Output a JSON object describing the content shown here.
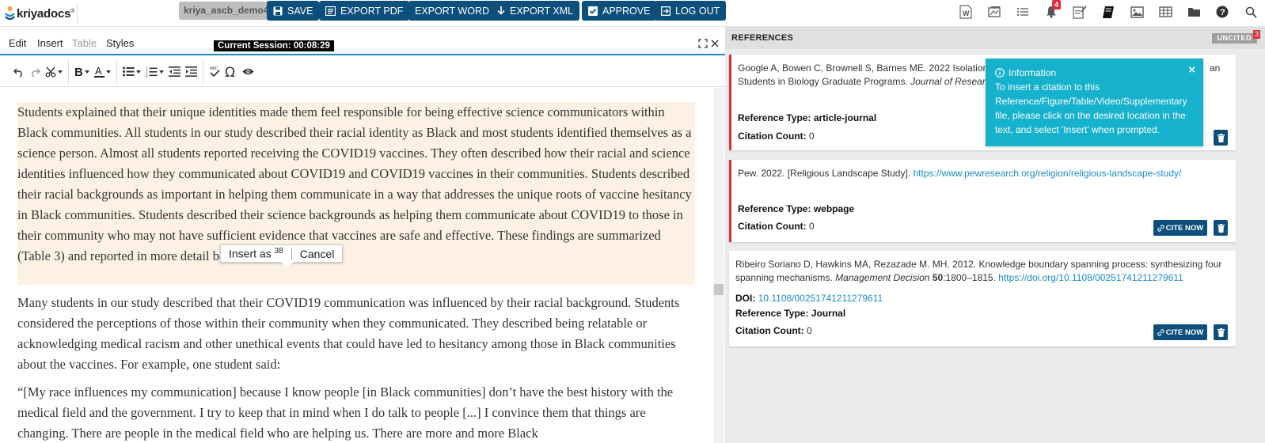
{
  "app": {
    "logo_text": "kriyadocs",
    "logo_mark": "®"
  },
  "topbar": {
    "user": "kriya_ascb_demo4",
    "buttons": [
      {
        "label": "SAVE",
        "icon": "save-icon"
      },
      {
        "label": "EXPORT PDF",
        "icon": "pdf-icon"
      },
      {
        "label": "EXPORT WORD",
        "icon": ""
      },
      {
        "label": "EXPORT XML",
        "icon": "download-icon"
      },
      {
        "label": "APPROVE",
        "icon": "check-icon"
      },
      {
        "label": "LOG OUT",
        "icon": "logout-icon"
      }
    ],
    "icons": [
      "word-icon",
      "image-gallery-icon",
      "list-icon",
      "bell-icon",
      "edit-notes-icon",
      "book-icon",
      "picture-icon",
      "table-icon",
      "folder-icon",
      "help-icon",
      "search-icon"
    ],
    "notification_count": "4"
  },
  "editor": {
    "menu": [
      "Edit",
      "Insert",
      "Table",
      "Styles"
    ],
    "session": "Current Session: 00:08:29",
    "paragraphs": [
      "Students explained that their unique identities made them feel responsible for being effective science communicators within Black communities. All students in our study described their racial identity as Black and most students identified themselves as a science person. Almost all students reported receiving the COVID19 vaccines. They often described how their racial and science identities influenced how they communicated about COVID19 and COVID19 vaccines in their communities. Students described their racial backgrounds as important in helping them communicate in a way that addresses the unique roots of vaccine hesitancy in Black communities. Students described their science backgrounds as helping them communicate about COVID19 to those in their community who may not have sufficient evidence that vaccines are safe and effective. These findings are summarized (Table 3) and reported in more detail below.",
      "Many students in our study described that their COVID19 communication was influenced by their racial background. Students considered the perceptions of those within their community when they communicated. They described being relatable or acknowledging medical racism and other unethical events that could have led to hesitancy among those in Black communities about the vaccines. For example, one student said:",
      "“[My race influences my communication] because I know people [in Black communities] don’t have the best history with the medical field and the government. I try to keep that in mind when I do talk to people [...] I convince them that things are changing. There are people in the medical field who are helping us. There are more and more Black"
    ],
    "popup": {
      "insert_label": "Insert as",
      "insert_sup": "38",
      "cancel_label": "Cancel"
    }
  },
  "references": {
    "header": "REFERENCES",
    "uncited_label": "UNCITED",
    "uncited_count": "3",
    "field_labels": {
      "type": "Reference Type:",
      "count": "Citation Count:",
      "doi": "DOI:"
    },
    "cite_label": "CITE NOW",
    "cards": [
      {
        "line1": "Google A, Bowen C, Brownell S, Barnes ME. 2022 Isolation",
        "line1_end": "an",
        "line2": "Students in Biology Graduate Programs.",
        "journal": "Journal of Researc",
        "type": "article-journal",
        "count": "0"
      },
      {
        "text": "Pew. 2022. [Religious Landscape Study].",
        "url": "https://www.pewresearch.org/religion/religious-landscape-study/",
        "type": "webpage",
        "count": "0"
      },
      {
        "line1": "Ribeiro Soriano D, Hawkins MA, Rezazade M. MH. 2012. Knowledge boundary spanning process: synthesizing four",
        "line2": "spanning mechanisms.",
        "journal": "Management Decision",
        "volume": "50",
        "pages": ":1800–1815.",
        "url": "https://doi.org/10.1108/00251741211279611",
        "doi": "10.1108/00251741211279611",
        "type": "Journal",
        "count": "0"
      }
    ],
    "info": {
      "title": "Information",
      "body": "To insert a citation to this Reference/Figure/Table/Video/Supplementary file, please click on the desired location in the text, and select 'Insert' when prompted.",
      "close": "×"
    }
  },
  "colors": {
    "primary": "#0d4f7c",
    "accent": "#1a8bc7",
    "info": "#16b1cc",
    "badge": "#d9303e",
    "highlight": "#fdf1e3"
  }
}
